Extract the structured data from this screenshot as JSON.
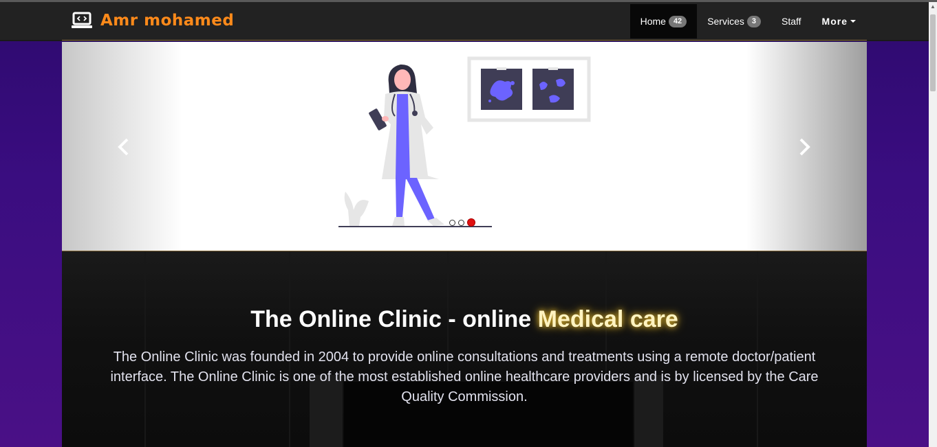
{
  "brand": {
    "name": "Amr mohamed",
    "icon": "laptop-code-icon"
  },
  "nav": {
    "items": [
      {
        "label": "Home",
        "badge": "42",
        "active": true
      },
      {
        "label": "Services",
        "badge": "3",
        "active": false
      },
      {
        "label": "Staff",
        "badge": null,
        "active": false
      },
      {
        "label": "More",
        "badge": null,
        "active": false,
        "dropdown": true
      }
    ]
  },
  "carousel": {
    "slide_icon": "doctor-illustration",
    "indicators": 3,
    "active_index": 2,
    "prev_icon": "chevron-left-icon",
    "next_icon": "chevron-right-icon"
  },
  "hero": {
    "title_main": "The Online Clinic - online ",
    "title_highlight": "Medical care",
    "text": "The Online Clinic was founded in 2004 to provide online consultations and treatments using a remote doctor/patient interface. The Online Clinic is one of the most established online healthcare providers and is by licensed by the Care Quality Commission."
  },
  "colors": {
    "brand": "#ff8a1a",
    "navbar_bg": "#222222",
    "page_bg": "#3a0d80",
    "accent_purple": "#6c63ff",
    "indicator_active": "#e01010",
    "highlight_glow": "#c9a227"
  }
}
